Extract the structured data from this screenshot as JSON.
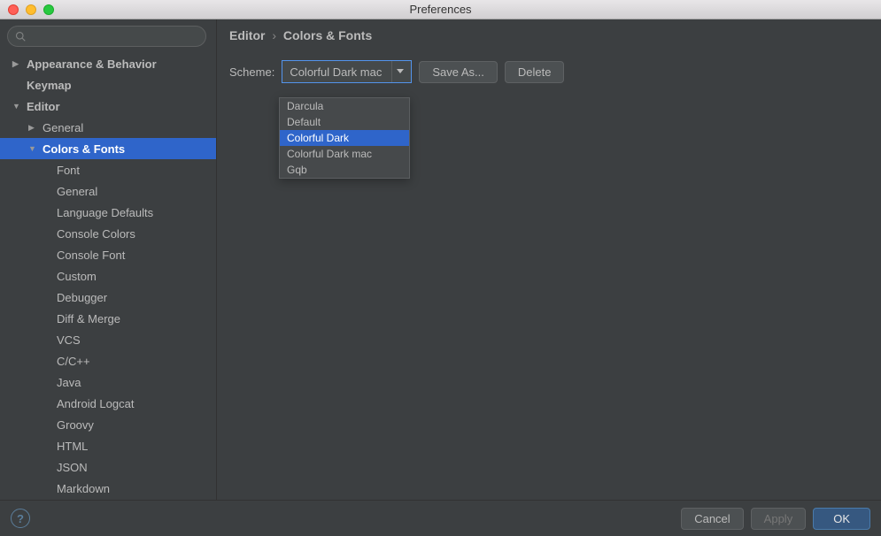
{
  "window": {
    "title": "Preferences"
  },
  "search": {
    "placeholder": ""
  },
  "sidebar": {
    "items": [
      {
        "label": "Appearance & Behavior",
        "depth": 0,
        "arrow": "right",
        "bold": true
      },
      {
        "label": "Keymap",
        "depth": 0,
        "arrow": "none",
        "bold": true,
        "padArrow": true
      },
      {
        "label": "Editor",
        "depth": 0,
        "arrow": "down",
        "bold": true
      },
      {
        "label": "General",
        "depth": 1,
        "arrow": "right",
        "bold": false
      },
      {
        "label": "Colors & Fonts",
        "depth": 1,
        "arrow": "down",
        "bold": true,
        "selected": true
      },
      {
        "label": "Font",
        "depth": 2,
        "arrow": "none",
        "bold": false
      },
      {
        "label": "General",
        "depth": 2,
        "arrow": "none",
        "bold": false
      },
      {
        "label": "Language Defaults",
        "depth": 2,
        "arrow": "none",
        "bold": false
      },
      {
        "label": "Console Colors",
        "depth": 2,
        "arrow": "none",
        "bold": false
      },
      {
        "label": "Console Font",
        "depth": 2,
        "arrow": "none",
        "bold": false
      },
      {
        "label": "Custom",
        "depth": 2,
        "arrow": "none",
        "bold": false
      },
      {
        "label": "Debugger",
        "depth": 2,
        "arrow": "none",
        "bold": false
      },
      {
        "label": "Diff & Merge",
        "depth": 2,
        "arrow": "none",
        "bold": false
      },
      {
        "label": "VCS",
        "depth": 2,
        "arrow": "none",
        "bold": false
      },
      {
        "label": "C/C++",
        "depth": 2,
        "arrow": "none",
        "bold": false
      },
      {
        "label": "Java",
        "depth": 2,
        "arrow": "none",
        "bold": false
      },
      {
        "label": "Android Logcat",
        "depth": 2,
        "arrow": "none",
        "bold": false
      },
      {
        "label": "Groovy",
        "depth": 2,
        "arrow": "none",
        "bold": false
      },
      {
        "label": "HTML",
        "depth": 2,
        "arrow": "none",
        "bold": false
      },
      {
        "label": "JSON",
        "depth": 2,
        "arrow": "none",
        "bold": false
      },
      {
        "label": "Markdown",
        "depth": 2,
        "arrow": "none",
        "bold": false
      }
    ]
  },
  "breadcrumb": {
    "parts": [
      "Editor",
      "Colors & Fonts"
    ],
    "sep": "›"
  },
  "scheme": {
    "label": "Scheme:",
    "selected": "Colorful Dark mac",
    "options": [
      {
        "label": "Darcula",
        "highlighted": false
      },
      {
        "label": "Default",
        "highlighted": false
      },
      {
        "label": "Colorful Dark",
        "highlighted": true
      },
      {
        "label": "Colorful Dark mac",
        "highlighted": false
      },
      {
        "label": "Gqb",
        "highlighted": false
      }
    ]
  },
  "buttons": {
    "saveAs": "Save As...",
    "delete": "Delete",
    "cancel": "Cancel",
    "apply": "Apply",
    "ok": "OK"
  }
}
